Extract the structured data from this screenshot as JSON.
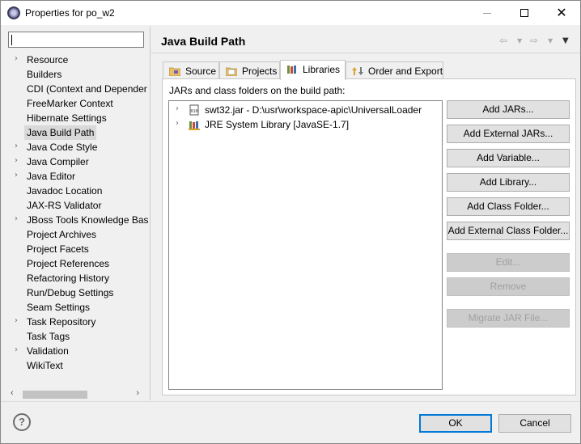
{
  "window": {
    "title": "Properties for po_w2"
  },
  "sidebar": {
    "filter_value": "",
    "items": [
      {
        "label": "Resource",
        "expandable": true
      },
      {
        "label": "Builders",
        "expandable": false
      },
      {
        "label": "CDI (Context and Depender",
        "expandable": false
      },
      {
        "label": "FreeMarker Context",
        "expandable": false
      },
      {
        "label": "Hibernate Settings",
        "expandable": false
      },
      {
        "label": "Java Build Path",
        "expandable": false,
        "selected": true
      },
      {
        "label": "Java Code Style",
        "expandable": true
      },
      {
        "label": "Java Compiler",
        "expandable": true
      },
      {
        "label": "Java Editor",
        "expandable": true
      },
      {
        "label": "Javadoc Location",
        "expandable": false
      },
      {
        "label": "JAX-RS Validator",
        "expandable": false
      },
      {
        "label": "JBoss Tools Knowledge Bas",
        "expandable": true
      },
      {
        "label": "Project Archives",
        "expandable": false
      },
      {
        "label": "Project Facets",
        "expandable": false
      },
      {
        "label": "Project References",
        "expandable": false
      },
      {
        "label": "Refactoring History",
        "expandable": false
      },
      {
        "label": "Run/Debug Settings",
        "expandable": false
      },
      {
        "label": "Seam Settings",
        "expandable": false
      },
      {
        "label": "Task Repository",
        "expandable": true
      },
      {
        "label": "Task Tags",
        "expandable": false
      },
      {
        "label": "Validation",
        "expandable": true
      },
      {
        "label": "WikiText",
        "expandable": false
      }
    ]
  },
  "main": {
    "title": "Java Build Path",
    "tabs": [
      {
        "label": "Source",
        "icon": "source-folder-icon",
        "active": false
      },
      {
        "label": "Projects",
        "icon": "projects-icon",
        "active": false
      },
      {
        "label": "Libraries",
        "icon": "libraries-icon",
        "active": true
      },
      {
        "label": "Order and Export",
        "icon": "order-export-icon",
        "active": false
      }
    ],
    "section_label": "JARs and class folders on the build path:",
    "entries": [
      {
        "label": "swt32.jar - D:\\usr\\workspace-apic\\UniversalLoader",
        "icon": "jar-file-icon"
      },
      {
        "label": "JRE System Library [JavaSE-1.7]",
        "icon": "library-icon"
      }
    ],
    "buttons": [
      {
        "label": "Add JARs...",
        "enabled": true
      },
      {
        "label": "Add External JARs...",
        "enabled": true
      },
      {
        "label": "Add Variable...",
        "enabled": true
      },
      {
        "label": "Add Library...",
        "enabled": true
      },
      {
        "label": "Add Class Folder...",
        "enabled": true
      },
      {
        "label": "Add External Class Folder...",
        "enabled": true
      },
      {
        "label": "Edit...",
        "enabled": false
      },
      {
        "label": "Remove",
        "enabled": false
      },
      {
        "label": "Migrate JAR File...",
        "enabled": false
      }
    ]
  },
  "footer": {
    "help_glyph": "?",
    "ok_label": "OK",
    "cancel_label": "Cancel"
  },
  "colors": {
    "accent": "#0078d7",
    "selection": "#d9d9d9"
  }
}
